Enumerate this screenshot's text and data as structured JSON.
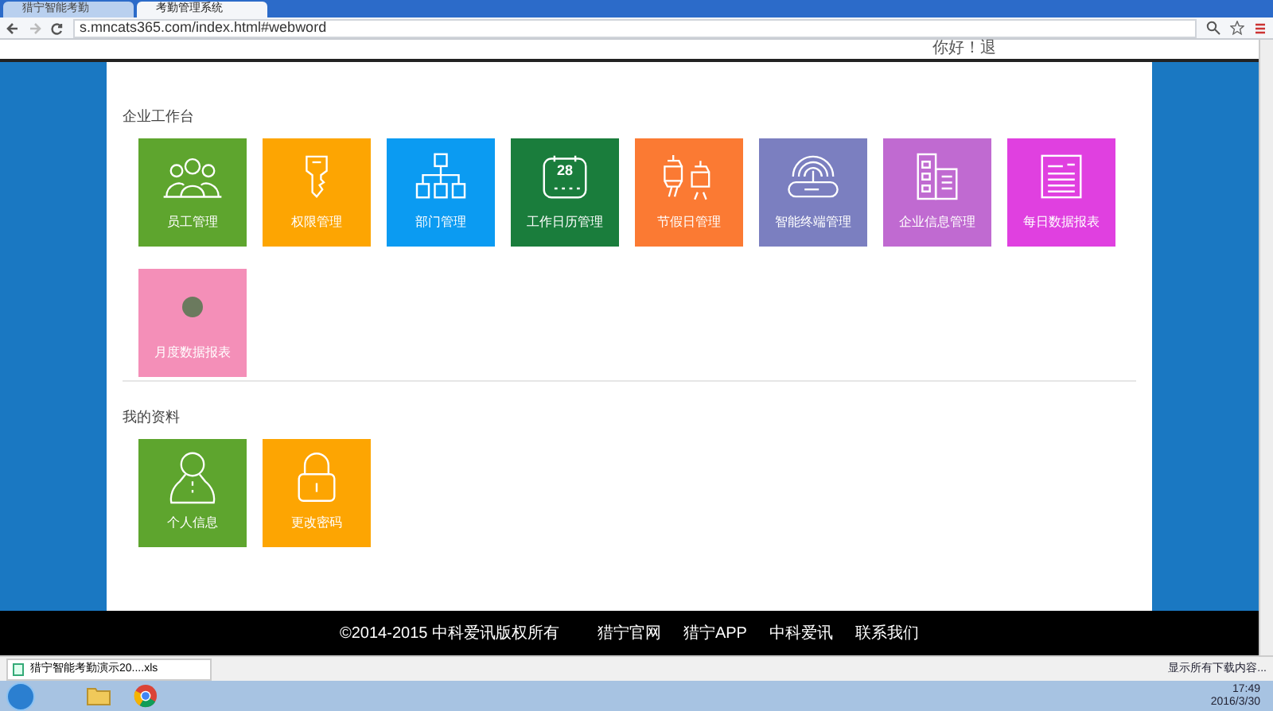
{
  "browser": {
    "tabs": [
      {
        "title": "猎宁智能考勤",
        "selected": false
      },
      {
        "title": "考勤管理系统",
        "selected": true
      }
    ],
    "url": "s.mncats365.com/index.html#webword"
  },
  "header": {
    "greeting": "你好！退"
  },
  "sections": [
    {
      "title": "企业工作台",
      "tiles": [
        {
          "label": "员工管理",
          "kind": "people",
          "color": "#5ea52e"
        },
        {
          "label": "权限管理",
          "kind": "key",
          "color": "#fda502"
        },
        {
          "label": "部门管理",
          "kind": "org",
          "color": "#0b9bf2"
        },
        {
          "label": "工作日历管理",
          "kind": "calendar",
          "color": "#1a7d3c",
          "icon_text": "28"
        },
        {
          "label": "节假日管理",
          "kind": "lantern",
          "color": "#fb7a33"
        },
        {
          "label": "智能终端管理",
          "kind": "router",
          "color": "#7b7fc0"
        },
        {
          "label": "企业信息管理",
          "kind": "building",
          "color": "#c06ad1"
        },
        {
          "label": "每日数据报表",
          "kind": "report",
          "color": "#e040e0"
        },
        {
          "label": "月度数据报表",
          "kind": "dot",
          "color": "#f48fb8"
        }
      ]
    },
    {
      "title": "我的资料",
      "tiles": [
        {
          "label": "个人信息",
          "kind": "person",
          "color": "#5ea52e"
        },
        {
          "label": "更改密码",
          "kind": "lock",
          "color": "#fda502"
        }
      ]
    }
  ],
  "footer": {
    "copyright": "©2014-2015 中科爱讯版权所有",
    "links": [
      "猎宁官网",
      "猎宁APP",
      "中科爱讯",
      "联系我们"
    ]
  },
  "download_bar": {
    "file": "猎宁智能考勤演示20....xls",
    "show_all": "显示所有下载内容..."
  },
  "taskbar": {
    "time": "17:49",
    "date": "2016/3/30"
  }
}
